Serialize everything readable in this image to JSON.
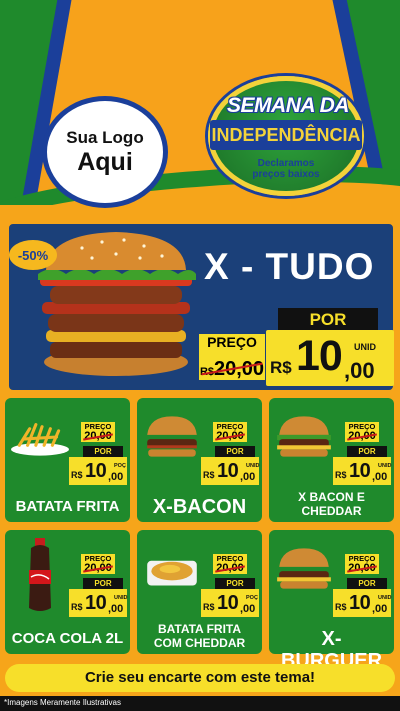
{
  "header": {
    "logo_line1": "Sua Logo",
    "logo_line2": "Aqui",
    "badge_line1": "SEMANA DA",
    "badge_line2": "INDEPENDÊNCIA",
    "badge_line3": "Declaramos",
    "badge_line4": "preços baixos"
  },
  "hero": {
    "title": "X - TUDO",
    "discount": "-50%",
    "preco_label": "PREÇO",
    "old_currency": "R$",
    "old_price": "20,00",
    "por_label": "POR",
    "currency": "R$",
    "price_int": "10",
    "price_dec": ",00",
    "unit": "UNID"
  },
  "products": [
    {
      "name": "BATATA FRITA",
      "preco_label": "PREÇO",
      "old_price": "20,00",
      "por_label": "POR",
      "currency": "R$",
      "price_int": "10",
      "price_dec": ",00",
      "unit": "POÇ"
    },
    {
      "name": "X-BACON",
      "preco_label": "PREÇO",
      "old_price": "20,00",
      "por_label": "POR",
      "currency": "R$",
      "price_int": "10",
      "price_dec": ",00",
      "unit": "UNID"
    },
    {
      "name": "X BACON E CHEDDAR",
      "preco_label": "PREÇO",
      "old_price": "20,00",
      "por_label": "POR",
      "currency": "R$",
      "price_int": "10",
      "price_dec": ",00",
      "unit": "UNID"
    },
    {
      "name": "COCA COLA 2L",
      "preco_label": "PREÇO",
      "old_price": "20,00",
      "por_label": "POR",
      "currency": "R$",
      "price_int": "10",
      "price_dec": ",00",
      "unit": "UNID"
    },
    {
      "name": "BATATA FRITA COM CHEDDAR",
      "preco_label": "PREÇO",
      "old_price": "20,00",
      "por_label": "POR",
      "currency": "R$",
      "price_int": "10",
      "price_dec": ",00",
      "unit": "POÇ"
    },
    {
      "name": "X-BURGUER",
      "preco_label": "PREÇO",
      "old_price": "20,00",
      "por_label": "POR",
      "currency": "R$",
      "price_int": "10",
      "price_dec": ",00",
      "unit": "UNID"
    }
  ],
  "footer": {
    "cta": "Crie seu encarte com este tema!",
    "note": "*Imagens Meramente Ilustrativas"
  },
  "colors": {
    "orange": "#f6a51a",
    "green": "#1f8a2c",
    "blue": "#1b3f9a",
    "navy": "#1b4079",
    "yellow": "#f7df2a"
  }
}
